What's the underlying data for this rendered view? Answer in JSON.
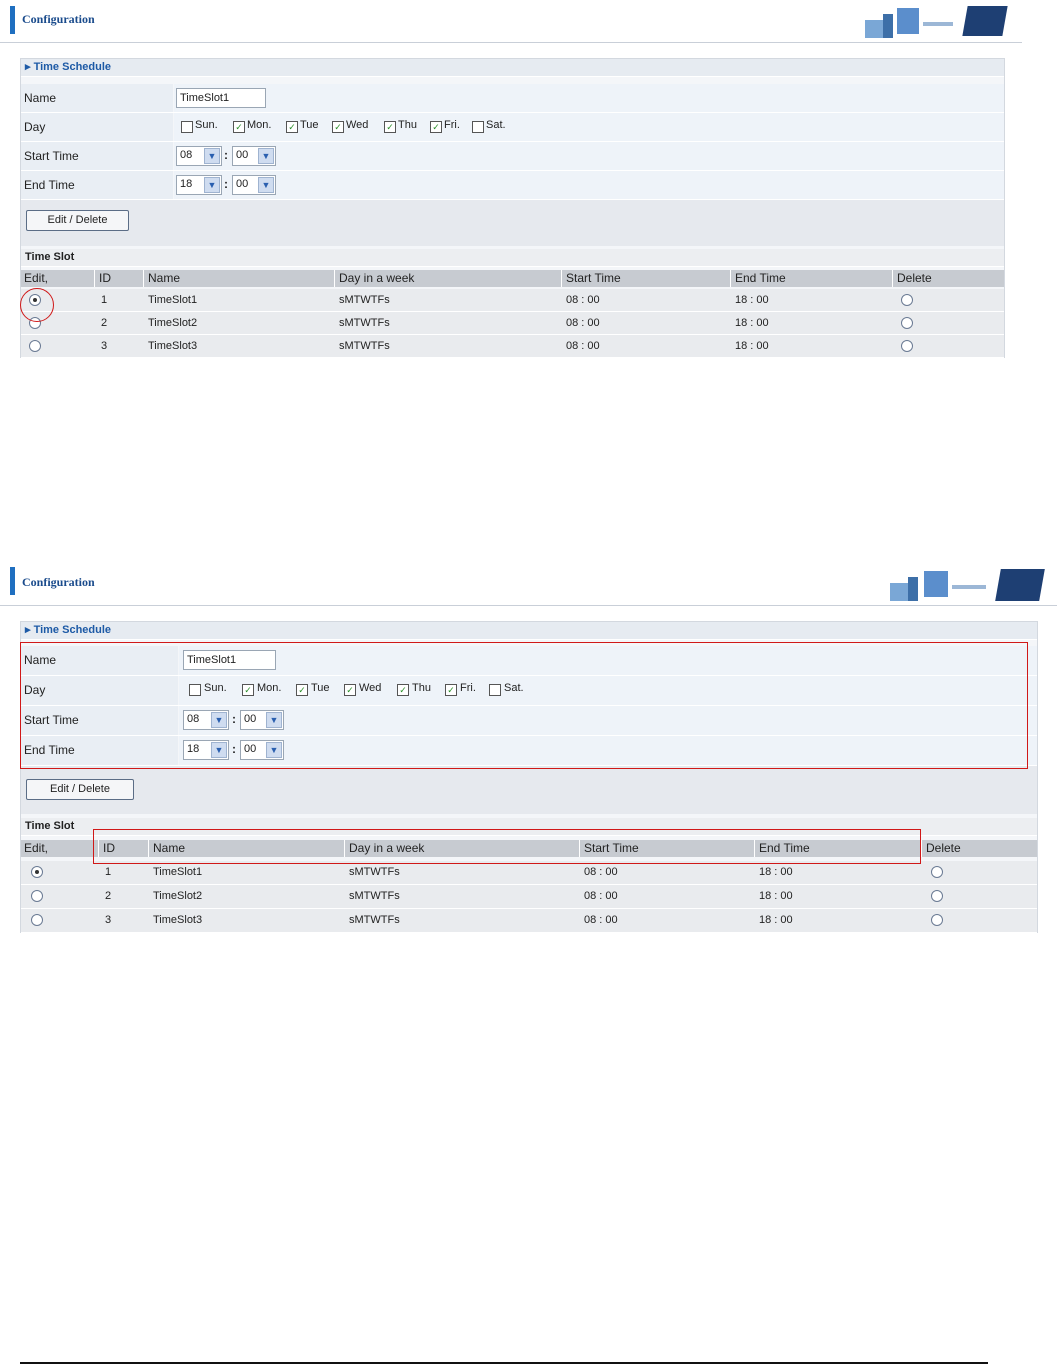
{
  "screenshots": [
    {
      "header": {
        "title": "Configuration"
      },
      "schedule": {
        "section_title": "Time Schedule",
        "name_label": "Name",
        "name_value": "TimeSlot1",
        "day_label": "Day",
        "days": [
          {
            "label": "Sun.",
            "checked": false
          },
          {
            "label": "Mon.",
            "checked": true
          },
          {
            "label": "Tue",
            "checked": true
          },
          {
            "label": "Wed",
            "checked": true
          },
          {
            "label": "Thu",
            "checked": true
          },
          {
            "label": "Fri.",
            "checked": true
          },
          {
            "label": "Sat.",
            "checked": false
          }
        ],
        "start_label": "Start Time",
        "start_hour": "08",
        "start_min": "00",
        "end_label": "End Time",
        "end_hour": "18",
        "end_min": "00",
        "button_label": "Edit / Delete"
      },
      "timeslot": {
        "section_title": "Time Slot",
        "columns": [
          "Edit,",
          "ID",
          "Name",
          "Day in a week",
          "Start Time",
          "End Time",
          "Delete"
        ],
        "rows": [
          {
            "selected": true,
            "id": "1",
            "name": "TimeSlot1",
            "days": "sMTWTFs",
            "start": "08 : 00",
            "end": "18 : 00"
          },
          {
            "selected": false,
            "id": "2",
            "name": "TimeSlot2",
            "days": "sMTWTFs",
            "start": "08 : 00",
            "end": "18 : 00"
          },
          {
            "selected": false,
            "id": "3",
            "name": "TimeSlot3",
            "days": "sMTWTFs",
            "start": "08 : 00",
            "end": "18 : 00"
          }
        ]
      }
    },
    {
      "header": {
        "title": "Configuration"
      },
      "schedule": {
        "section_title": "Time Schedule",
        "name_label": "Name",
        "name_value": "TimeSlot1",
        "day_label": "Day",
        "days": [
          {
            "label": "Sun.",
            "checked": false
          },
          {
            "label": "Mon.",
            "checked": true
          },
          {
            "label": "Tue",
            "checked": true
          },
          {
            "label": "Wed",
            "checked": true
          },
          {
            "label": "Thu",
            "checked": true
          },
          {
            "label": "Fri.",
            "checked": true
          },
          {
            "label": "Sat.",
            "checked": false
          }
        ],
        "start_label": "Start Time",
        "start_hour": "08",
        "start_min": "00",
        "end_label": "End Time",
        "end_hour": "18",
        "end_min": "00",
        "button_label": "Edit / Delete"
      },
      "timeslot": {
        "section_title": "Time Slot",
        "columns": [
          "Edit,",
          "ID",
          "Name",
          "Day in a week",
          "Start Time",
          "End Time",
          "Delete"
        ],
        "rows": [
          {
            "selected": true,
            "id": "1",
            "name": "TimeSlot1",
            "days": "sMTWTFs",
            "start": "08 : 00",
            "end": "18 : 00"
          },
          {
            "selected": false,
            "id": "2",
            "name": "TimeSlot2",
            "days": "sMTWTFs",
            "start": "08 : 00",
            "end": "18 : 00"
          },
          {
            "selected": false,
            "id": "3",
            "name": "TimeSlot3",
            "days": "sMTWTFs",
            "start": "08 : 00",
            "end": "18 : 00"
          }
        ]
      }
    }
  ]
}
